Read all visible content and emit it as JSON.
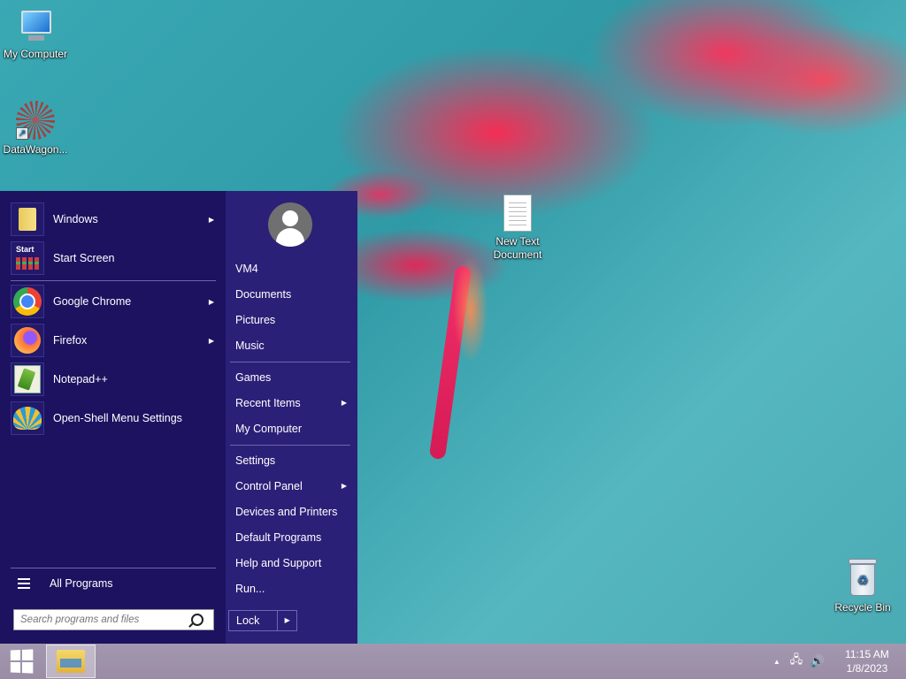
{
  "desktop": {
    "icons": [
      {
        "label": "My Computer"
      },
      {
        "label": "DataWagon..."
      },
      {
        "label": "New Text Document"
      },
      {
        "label": "Recycle Bin"
      }
    ]
  },
  "start_menu": {
    "pinned": [
      {
        "label": "Windows",
        "icon": "folder-icon",
        "has_submenu": true
      },
      {
        "label": "Start Screen",
        "icon": "start-screen-icon",
        "icon_text": "Start",
        "has_submenu": false
      }
    ],
    "programs": [
      {
        "label": "Google Chrome",
        "icon": "chrome-icon",
        "has_submenu": true
      },
      {
        "label": "Firefox",
        "icon": "firefox-icon",
        "has_submenu": true
      },
      {
        "label": "Notepad++",
        "icon": "notepad-plus-plus-icon",
        "has_submenu": false
      },
      {
        "label": "Open-Shell Menu Settings",
        "icon": "open-shell-icon",
        "has_submenu": false
      }
    ],
    "all_programs_label": "All Programs",
    "search_placeholder": "Search programs and files",
    "right_items": [
      {
        "label": "VM4",
        "has_submenu": false
      },
      {
        "label": "Documents",
        "has_submenu": false
      },
      {
        "label": "Pictures",
        "has_submenu": false
      },
      {
        "label": "Music",
        "has_submenu": false
      },
      {
        "label": "Games",
        "has_submenu": false
      },
      {
        "label": "Recent Items",
        "has_submenu": true
      },
      {
        "label": "My Computer",
        "has_submenu": false
      },
      {
        "label": "Settings",
        "has_submenu": false
      },
      {
        "label": "Control Panel",
        "has_submenu": true
      },
      {
        "label": "Devices and Printers",
        "has_submenu": false
      },
      {
        "label": "Default Programs",
        "has_submenu": false
      },
      {
        "label": "Help and Support",
        "has_submenu": false
      },
      {
        "label": "Run...",
        "has_submenu": false
      }
    ],
    "lock_label": "Lock",
    "submenu_arrow": "▶"
  },
  "taskbar": {
    "clock_time": "11:15 AM",
    "clock_date": "1/8/2023",
    "tray_icons": [
      "show-hidden-icons-chevron",
      "network-icon",
      "volume-icon"
    ]
  },
  "colors": {
    "menu_left": "#1c1260",
    "menu_right": "#2b2078",
    "taskbar": "#9f93ab",
    "desktop_teal": "#3aa9b4",
    "flower_red": "#e8255f"
  }
}
